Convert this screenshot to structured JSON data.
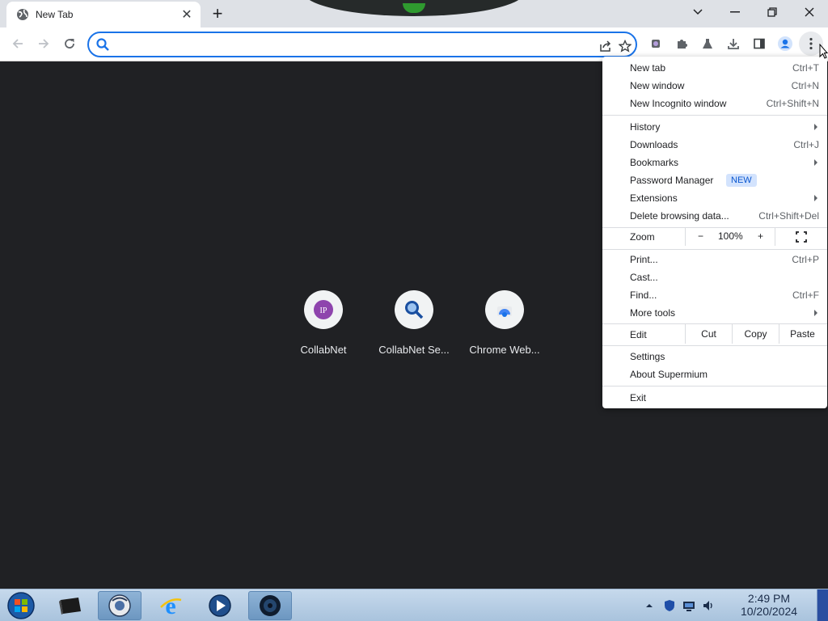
{
  "tab": {
    "title": "New Tab"
  },
  "window_controls": {
    "search_tabs": "⌄",
    "minimize": "—",
    "restore": "❐",
    "close": "✕"
  },
  "omnibox": {
    "value": "",
    "placeholder": ""
  },
  "shortcuts": [
    {
      "label": "CollabNet",
      "icon": "collabnet-ip-icon"
    },
    {
      "label": "CollabNet Se...",
      "icon": "search-magnifier-icon"
    },
    {
      "label": "Chrome Web...",
      "icon": "chrome-web-store-icon"
    }
  ],
  "menu": {
    "new_tab": {
      "label": "New tab",
      "shortcut": "Ctrl+T"
    },
    "new_window": {
      "label": "New window",
      "shortcut": "Ctrl+N"
    },
    "new_incognito": {
      "label": "New Incognito window",
      "shortcut": "Ctrl+Shift+N"
    },
    "history": {
      "label": "History"
    },
    "downloads": {
      "label": "Downloads",
      "shortcut": "Ctrl+J"
    },
    "bookmarks": {
      "label": "Bookmarks"
    },
    "password_manager": {
      "label": "Password Manager",
      "badge": "NEW"
    },
    "extensions": {
      "label": "Extensions"
    },
    "delete_browsing": {
      "label": "Delete browsing data...",
      "shortcut": "Ctrl+Shift+Del"
    },
    "zoom": {
      "label": "Zoom",
      "minus": "−",
      "value": "100%",
      "plus": "+"
    },
    "print": {
      "label": "Print...",
      "shortcut": "Ctrl+P"
    },
    "cast": {
      "label": "Cast..."
    },
    "find": {
      "label": "Find...",
      "shortcut": "Ctrl+F"
    },
    "more_tools": {
      "label": "More tools"
    },
    "edit": {
      "label": "Edit",
      "cut": "Cut",
      "copy": "Copy",
      "paste": "Paste"
    },
    "settings": {
      "label": "Settings"
    },
    "about": {
      "label": "About Supermium"
    },
    "exit": {
      "label": "Exit"
    }
  },
  "taskbar": {
    "clock_time": "2:49 PM",
    "clock_date": "10/20/2024"
  },
  "colors": {
    "accent": "#1a73e8",
    "ntp_background": "#202124",
    "badge_bg": "#d3e3fd",
    "collabnet_purple": "#8e44ad"
  }
}
